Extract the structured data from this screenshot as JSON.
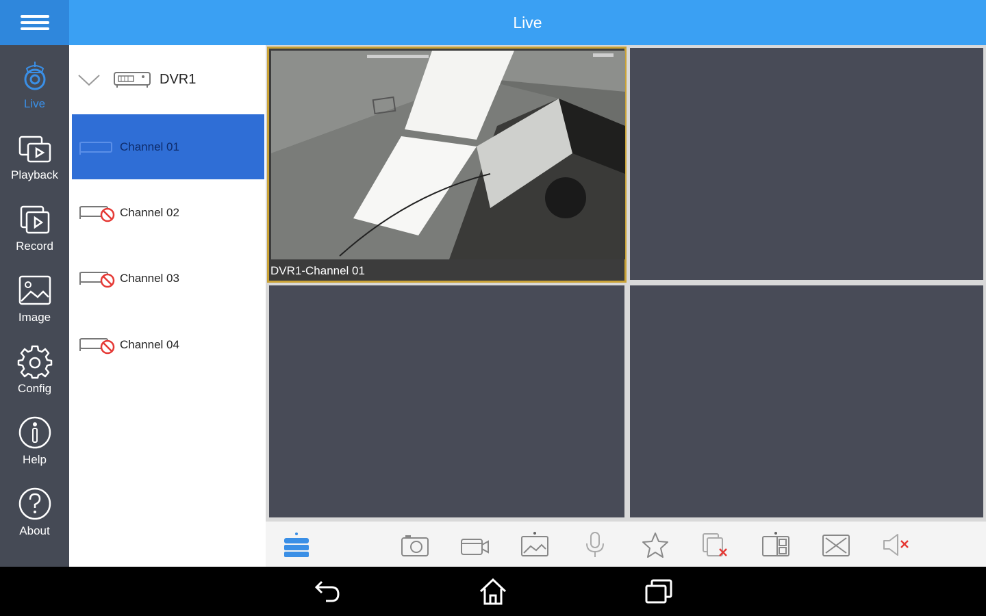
{
  "app": {
    "title": "Live"
  },
  "nav": {
    "items": [
      {
        "label": "Live",
        "icon": "camera-icon",
        "active": true
      },
      {
        "label": "Playback",
        "icon": "playback-icon"
      },
      {
        "label": "Record",
        "icon": "record-icon"
      },
      {
        "label": "Image",
        "icon": "image-icon"
      },
      {
        "label": "Config",
        "icon": "gear-icon"
      },
      {
        "label": "Help",
        "icon": "info-icon"
      },
      {
        "label": "About",
        "icon": "question-icon"
      }
    ]
  },
  "tree": {
    "device": {
      "name": "DVR1",
      "expanded": true
    },
    "channels": [
      {
        "name": "Channel 01",
        "selected": true,
        "status": "online"
      },
      {
        "name": "Channel 02",
        "status": "offline"
      },
      {
        "name": "Channel 03",
        "status": "offline"
      },
      {
        "name": "Channel 04",
        "status": "offline"
      }
    ]
  },
  "grid": {
    "panes": [
      {
        "label": "DVR1-Channel 01",
        "active": true
      },
      {
        "label": ""
      },
      {
        "label": ""
      },
      {
        "label": ""
      }
    ]
  },
  "toolbar": {
    "buttons": [
      "layout-icon",
      "snapshot-icon",
      "record-video-icon",
      "stream-quality-icon",
      "microphone-icon",
      "favorite-star-icon",
      "close-channel-icon",
      "split-view-icon",
      "fullscreen-icon",
      "mute-icon"
    ]
  },
  "colors": {
    "accent": "#3aa0f3",
    "selected": "#2f6ed6",
    "sidebar": "#454a55",
    "active_border": "#c9a236"
  }
}
